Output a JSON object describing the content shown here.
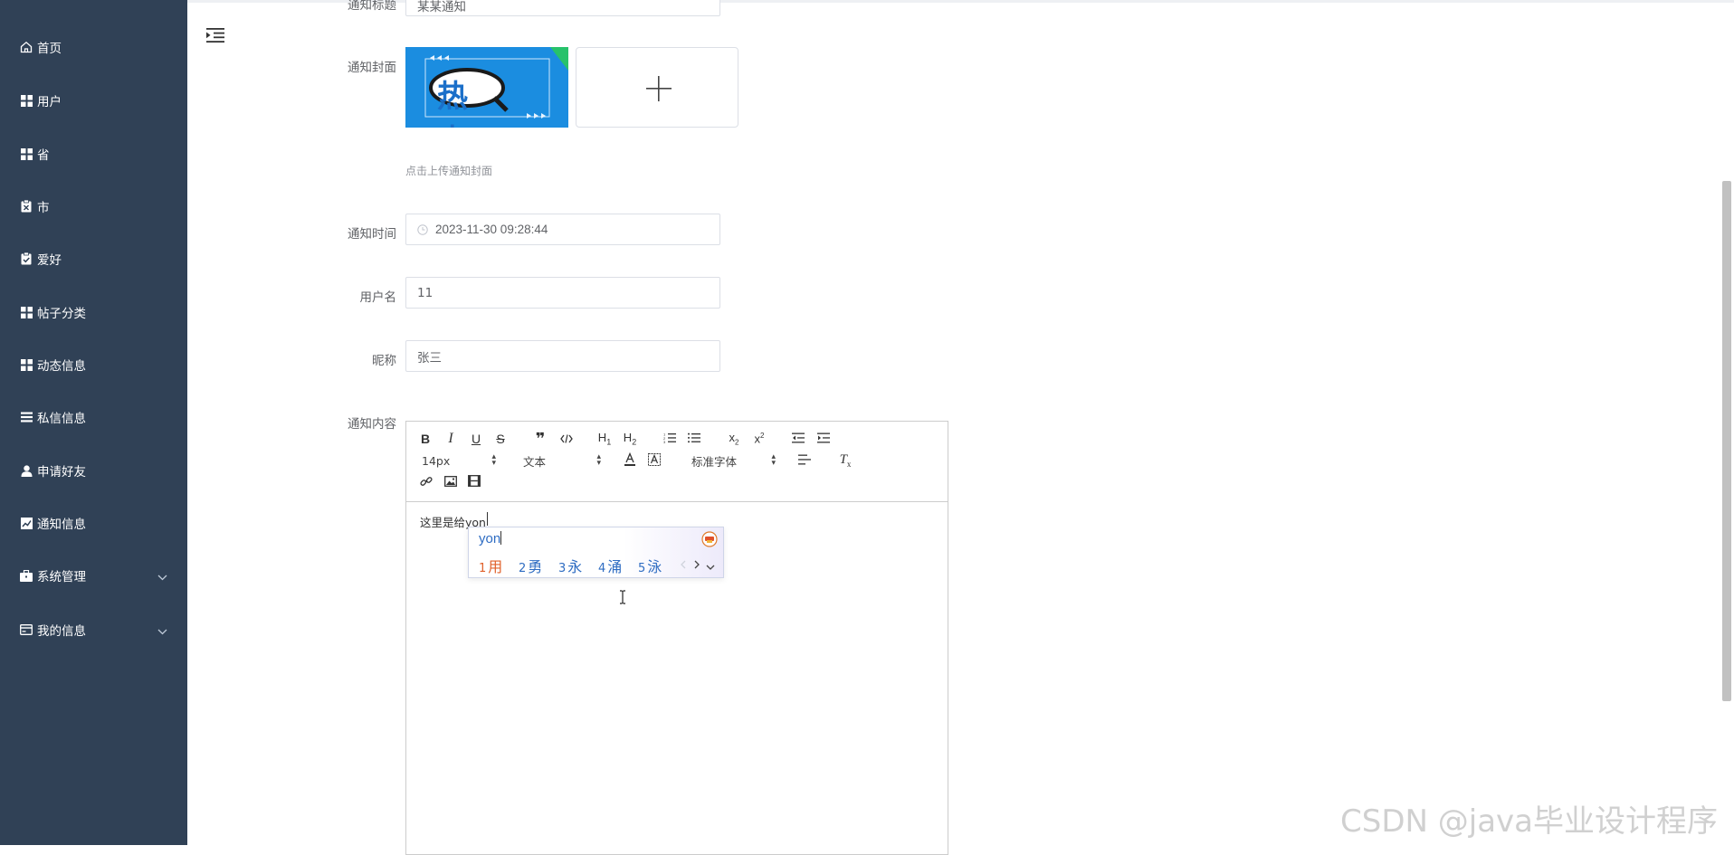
{
  "sidebar": {
    "items": [
      {
        "label": "首页",
        "icon": "home-icon"
      },
      {
        "label": "用户",
        "icon": "grid-icon"
      },
      {
        "label": "省",
        "icon": "grid-icon"
      },
      {
        "label": "市",
        "icon": "clipboard-x-icon"
      },
      {
        "label": "爱好",
        "icon": "clipboard-check-icon"
      },
      {
        "label": "帖子分类",
        "icon": "grid-icon"
      },
      {
        "label": "动态信息",
        "icon": "grid-icon"
      },
      {
        "label": "私信信息",
        "icon": "list-icon"
      },
      {
        "label": "申请好友",
        "icon": "user-icon"
      },
      {
        "label": "通知信息",
        "icon": "chart-icon"
      },
      {
        "label": "系统管理",
        "icon": "briefcase-icon",
        "expandable": true
      },
      {
        "label": "我的信息",
        "icon": "card-icon",
        "expandable": true
      }
    ],
    "background": "#304156"
  },
  "form": {
    "title_label": "通知标题",
    "title_value": "某某通知",
    "cover_label": "通知封面",
    "cover_image_text": "热点",
    "upload_hint": "点击上传通知封面",
    "time_label": "通知时间",
    "time_value": "2023-11-30 09:28:44",
    "username_label": "用户名",
    "username_value": "11",
    "nickname_label": "昵称",
    "nickname_value": "张三",
    "content_label": "通知内容"
  },
  "editor": {
    "font_size": "14px",
    "text_type": "文本",
    "font_family": "标准字体",
    "content": "这里是给yon"
  },
  "ime": {
    "pinyin": "yon",
    "candidates": [
      {
        "num": "1",
        "char": "用"
      },
      {
        "num": "2",
        "char": "勇"
      },
      {
        "num": "3",
        "char": "永"
      },
      {
        "num": "4",
        "char": "涌"
      },
      {
        "num": "5",
        "char": "泳"
      }
    ]
  },
  "watermark": "CSDN @java毕业设计程序"
}
